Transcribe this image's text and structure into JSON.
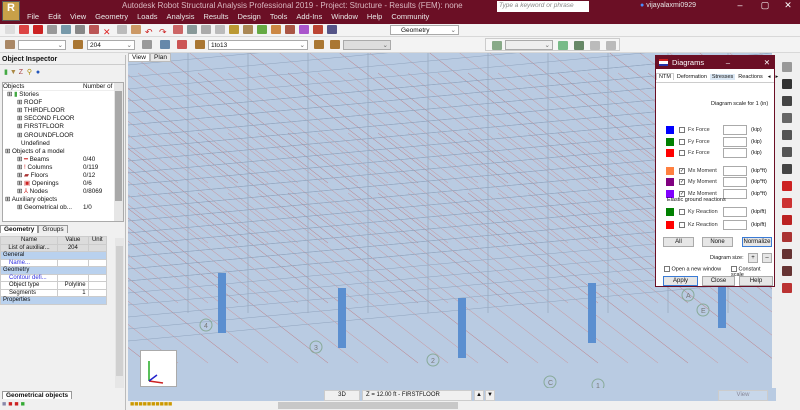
{
  "titlebar": {
    "logo": "R",
    "title": "Autodesk Robot Structural Analysis Professional 2019 - Project: Structure - Results (FEM): none",
    "search_placeholder": "Type a keyword or phrase",
    "user": "vijayalaxmi0929",
    "minimize": "–",
    "maximize": "▢",
    "close": "✕"
  },
  "menu": [
    "File",
    "Edit",
    "View",
    "Geometry",
    "Loads",
    "Analysis",
    "Results",
    "Design",
    "Tools",
    "Add-Ins",
    "Window",
    "Help",
    "Community"
  ],
  "toolbar": {
    "combo1": "",
    "combo2": "204",
    "combo3": "1to13",
    "combo4": "Geometry",
    "combo5": ""
  },
  "inspector": {
    "title": "Object Inspector",
    "col_objects": "Objects",
    "col_number": "Number of o",
    "tree": [
      {
        "label": "Stories",
        "count": ""
      },
      {
        "label": "ROOF",
        "count": ""
      },
      {
        "label": "THIRDFLOOR",
        "count": ""
      },
      {
        "label": "SECOND FLOOR",
        "count": ""
      },
      {
        "label": "FIRSTFLOOR",
        "count": ""
      },
      {
        "label": "GROUNDFLOOR",
        "count": ""
      },
      {
        "label": "Undefined",
        "count": ""
      },
      {
        "label": "Objects of a model",
        "count": ""
      },
      {
        "label": "Beams",
        "count": "0/40"
      },
      {
        "label": "Columns",
        "count": "0/119"
      },
      {
        "label": "Floors",
        "count": "0/12"
      },
      {
        "label": "Openings",
        "count": "0/6"
      },
      {
        "label": "Nodes",
        "count": "0/8069"
      },
      {
        "label": "Auxiliary objects",
        "count": ""
      },
      {
        "label": "Geometrical ob...",
        "count": "1/0"
      }
    ],
    "tabs": [
      "Geometry",
      "Groups"
    ],
    "grid_headers": [
      "Name",
      "Value",
      "Unit"
    ],
    "grid": {
      "list": "List of auxiliar...",
      "list_val": "204",
      "general": "General",
      "name": "Name...",
      "geometry": "Geometry",
      "contour": "Contour defi...",
      "objtype": "Object type",
      "objtype_val": "Polyline",
      "segments": "Segments",
      "segments_val": "1",
      "properties": "Properties"
    },
    "bottom_tab": "Geometrical objects"
  },
  "view": {
    "tabs": [
      "View",
      "Plan"
    ],
    "grid_labels": [
      "4",
      "3",
      "2",
      "1",
      "E",
      "C",
      "A"
    ]
  },
  "status": {
    "mode": "3D",
    "level": "Z = 12.00 ft - FIRSTFLOOR",
    "view": "View"
  },
  "diagrams": {
    "title": "Diagrams",
    "tabs": [
      "NTM",
      "Deformation",
      "Stresses",
      "Reactions"
    ],
    "scale_label": "Diagram scale for 1  (in)",
    "rows": [
      {
        "label": "Fx Force",
        "unit": "(kip)",
        "color": "#0000ff",
        "checked": false
      },
      {
        "label": "Fy Force",
        "unit": "(kip)",
        "color": "#008000",
        "checked": false
      },
      {
        "label": "Fz Force",
        "unit": "(kip)",
        "color": "#ff0000",
        "checked": false
      },
      {
        "label": "Mx Moment",
        "unit": "(kip*ft)",
        "color": "#ff8040",
        "checked": true
      },
      {
        "label": "My Moment",
        "unit": "(kip*ft)",
        "color": "#800080",
        "checked": true
      },
      {
        "label": "Mz Moment",
        "unit": "(kip*ft)",
        "color": "#8000ff",
        "checked": true
      }
    ],
    "elastic_label": "Elastic ground reactions",
    "reactions": [
      {
        "label": "Ky Reaction",
        "unit": "(kip/ft)",
        "color": "#008000"
      },
      {
        "label": "Kz Reaction",
        "unit": "(kip/ft)",
        "color": "#ff0000"
      }
    ],
    "all": "All",
    "none": "None",
    "normalize": "Normalize",
    "size_label": "Diagram size:",
    "plus": "+",
    "minus": "–",
    "open_new": "Open a new window",
    "constant": "Constant scale",
    "apply": "Apply",
    "close": "Close",
    "help": "Help"
  }
}
